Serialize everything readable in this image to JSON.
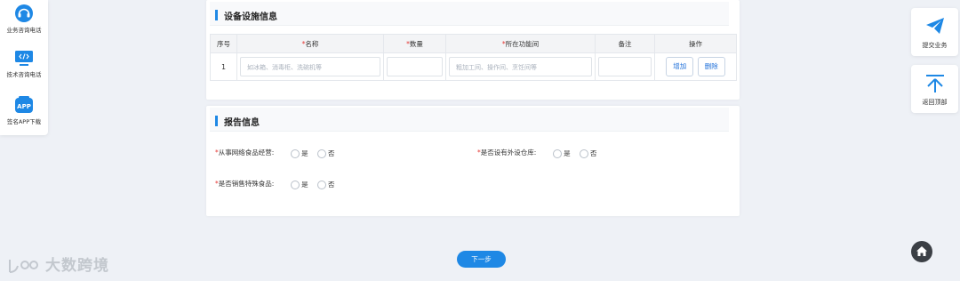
{
  "left_panel": {
    "items": [
      {
        "label": "业务咨询电话",
        "icon": "headset-icon"
      },
      {
        "label": "技术咨询电话",
        "icon": "code-monitor-icon"
      },
      {
        "label": "签名APP下载",
        "icon": "app-download-icon"
      }
    ]
  },
  "right_panel": {
    "submit_label": "提交业务",
    "top_label": "返回顶部"
  },
  "equipment": {
    "title": "设备设施信息",
    "columns": {
      "index": "序号",
      "name": "名称",
      "quantity": "数量",
      "location": "所在功能间",
      "remark": "备注",
      "action": "操作"
    },
    "required_mark": "*",
    "rows": [
      {
        "index": "1",
        "name_placeholder": "如冰箱、消毒柜、洗碗机等",
        "quantity_value": "",
        "location_placeholder": "粗加工间、操作间、烹饪间等",
        "remark_value": "",
        "add_label": "增加",
        "delete_label": "删除"
      }
    ]
  },
  "report": {
    "title": "报告信息",
    "questions": [
      {
        "label": "从事网络食品经营:",
        "yes": "是",
        "no": "否"
      },
      {
        "label": "是否设有外设仓库:",
        "yes": "是",
        "no": "否"
      },
      {
        "label": "是否销售特殊食品:",
        "yes": "是",
        "no": "否"
      }
    ]
  },
  "footer": {
    "next_label": "下一步",
    "watermark": "大数跨境"
  },
  "colors": {
    "accent": "#1e88e5",
    "required": "#e53935",
    "background": "#eef1f6"
  }
}
